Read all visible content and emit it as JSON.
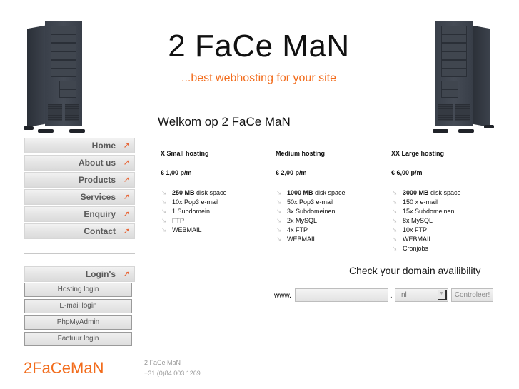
{
  "header": {
    "title": "2 FaCe MaN",
    "tagline": "...best webhosting for your site",
    "welcome": "Welkom op 2 FaCe MaN",
    "images": [
      "server-tower-left",
      "server-tower-right"
    ]
  },
  "menu": {
    "items": [
      {
        "label": "Home",
        "icon": "arrow-icon"
      },
      {
        "label": "About us",
        "icon": "arrow-icon"
      },
      {
        "label": "Products",
        "icon": "arrow-icon"
      },
      {
        "label": "Services",
        "icon": "arrow-icon"
      },
      {
        "label": "Enquiry",
        "icon": "arrow-icon"
      },
      {
        "label": "Contact",
        "icon": "arrow-icon"
      }
    ],
    "arrow_glyph": "➚",
    "accent": "#e8683a"
  },
  "logins": {
    "header": "Login's",
    "buttons": [
      "Hosting login",
      "E-mail login",
      "PhpMyAdmin",
      "Factuur login"
    ]
  },
  "plans": [
    {
      "name": "X Small hosting",
      "price": "€ 1,00 p/m",
      "features": [
        {
          "bold": "250 MB",
          "text": " disk space"
        },
        {
          "bold": "",
          "text": "10x Pop3 e-mail"
        },
        {
          "bold": "",
          "text": "1 Subdomein"
        },
        {
          "bold": "",
          "text": "FTP"
        },
        {
          "bold": "",
          "text": "WEBMAIL"
        }
      ]
    },
    {
      "name": "Medium hosting",
      "price": "€ 2,00 p/m",
      "features": [
        {
          "bold": "1000 MB",
          "text": " disk space"
        },
        {
          "bold": "",
          "text": "50x Pop3 e-mail"
        },
        {
          "bold": "",
          "text": "3x Subdomeinen"
        },
        {
          "bold": "",
          "text": "2x MySQL"
        },
        {
          "bold": "",
          "text": "4x FTP"
        },
        {
          "bold": "",
          "text": "WEBMAIL"
        }
      ]
    },
    {
      "name": "XX Large hosting",
      "price": "€ 6,00 p/m",
      "features": [
        {
          "bold": "3000 MB",
          "text": " disk space"
        },
        {
          "bold": "",
          "text": "150 x e-mail"
        },
        {
          "bold": "",
          "text": "15x Subdomeinen"
        },
        {
          "bold": "",
          "text": "8x MySQL"
        },
        {
          "bold": "",
          "text": "10x FTP"
        },
        {
          "bold": "",
          "text": "WEBMAIL"
        },
        {
          "bold": "",
          "text": "Cronjobs"
        }
      ]
    }
  ],
  "bullet_glyph": "➘",
  "domain_check": {
    "heading": "Check your domain availibility",
    "prefix": "www.",
    "input_value": "",
    "separator": ".",
    "tld_selected": "nl",
    "button_label": "Controleer!"
  },
  "footer": {
    "logo": "2FaCeMaN",
    "name": "2 FaCe MaN",
    "phone": "+31 (0)84 003 1269"
  },
  "colors": {
    "accent": "#f26c1c",
    "text": "#111111",
    "muted": "#999999"
  }
}
